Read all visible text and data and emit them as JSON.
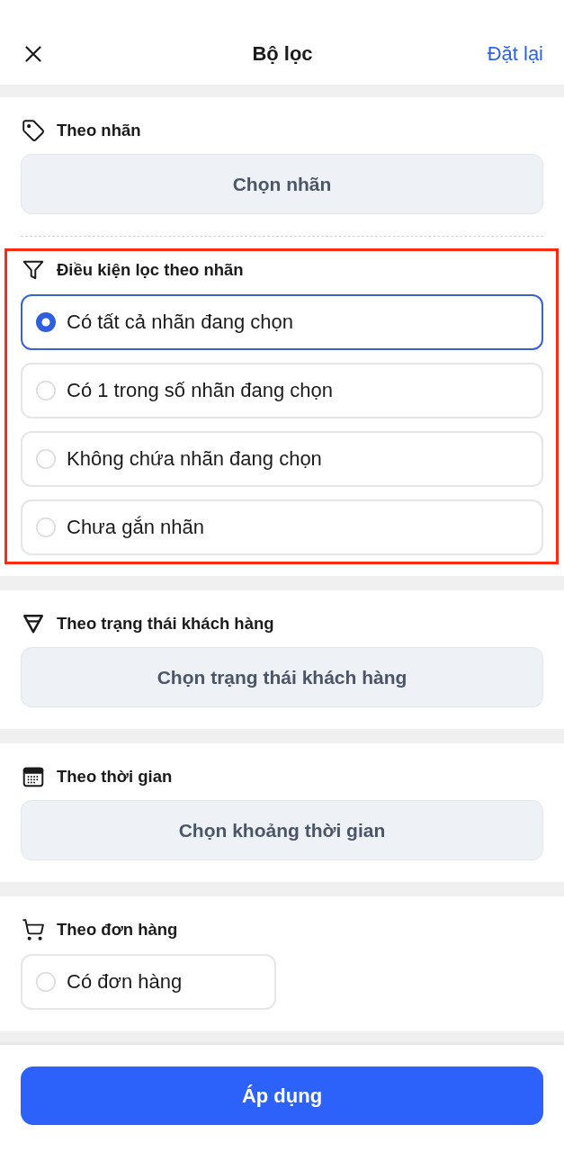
{
  "header": {
    "title": "Bộ lọc",
    "reset_label": "Đặt lại"
  },
  "sections": [
    {
      "kind": "picker",
      "title": "Theo nhãn",
      "button": "Chọn nhãn",
      "condition": {
        "title": "Điều kiện lọc theo nhãn",
        "highlighted": true,
        "options": [
          {
            "label": "Có tất cả nhãn đang chọn",
            "selected": true
          },
          {
            "label": "Có 1 trong số nhãn đang chọn",
            "selected": false
          },
          {
            "label": "Không chứa nhãn đang chọn",
            "selected": false
          },
          {
            "label": "Chưa gắn nhãn",
            "selected": false
          }
        ]
      }
    },
    {
      "kind": "picker",
      "title": "Theo trạng thái khách hàng",
      "button": "Chọn trạng thái khách hàng"
    },
    {
      "kind": "picker",
      "title": "Theo thời gian",
      "button": "Chọn khoảng thời gian"
    },
    {
      "kind": "options",
      "title": "Theo đơn hàng",
      "options": [
        {
          "label": "Có đơn hàng",
          "selected": false
        }
      ]
    }
  ],
  "apply_button": "Áp dụng"
}
